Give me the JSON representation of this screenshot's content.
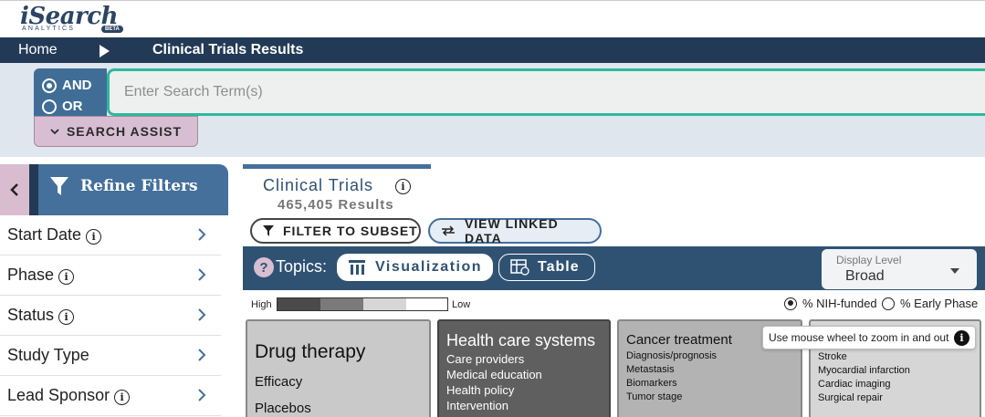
{
  "logo": {
    "main": "iSearch",
    "sub": "ANALYTICS",
    "badge": "BETA"
  },
  "breadcrumb": {
    "home": "Home",
    "current": "Clinical Trials Results"
  },
  "search": {
    "operators": [
      "AND",
      "OR"
    ],
    "selected_operator": "AND",
    "placeholder": "Enter Search Term(s)",
    "value": "",
    "assist_label": "SEARCH ASSIST"
  },
  "sidebar": {
    "title": "Refine Filters",
    "items": [
      {
        "label": "Start Date"
      },
      {
        "label": "Phase"
      },
      {
        "label": "Status"
      },
      {
        "label": "Study Type"
      },
      {
        "label": "Lead Sponsor"
      }
    ]
  },
  "main": {
    "tab": {
      "title": "Clinical Trials",
      "results": "465,405 Results"
    },
    "filter_subset_label": "FILTER TO SUBSET",
    "view_linked_label": "VIEW LINKED DATA",
    "topics_label": "Topics:",
    "visualization_label": "Visualization",
    "table_label": "Table",
    "display_level": {
      "label": "Display Level",
      "value": "Broad"
    },
    "legend": {
      "high": "High",
      "low": "Low"
    },
    "metrics": [
      {
        "label": "% NIH-funded",
        "selected": true
      },
      {
        "label": "% Early Phase",
        "selected": false
      }
    ],
    "tooltip": "Use mouse wheel to zoom in and out",
    "tiles": [
      {
        "title": "Drug therapy",
        "items": [
          "Efficacy",
          "Placebos"
        ]
      },
      {
        "title": "Health care systems",
        "items": [
          "Care providers",
          "Medical education",
          "Health policy",
          "Intervention"
        ]
      },
      {
        "title": "Cancer treatment",
        "items": [
          "Diagnosis/prognosis",
          "Metastasis",
          "Biomarkers",
          "Tumor stage"
        ]
      },
      {
        "title": "",
        "items": [
          "Stroke",
          "Myocardial infarction",
          "Cardiac imaging",
          "Surgical repair"
        ]
      }
    ]
  },
  "colors": {
    "nav_dark": "#223a56",
    "panel_blue": "#44709b",
    "accent_teal": "#2fb89c",
    "accent_pink": "#d8bed2"
  }
}
